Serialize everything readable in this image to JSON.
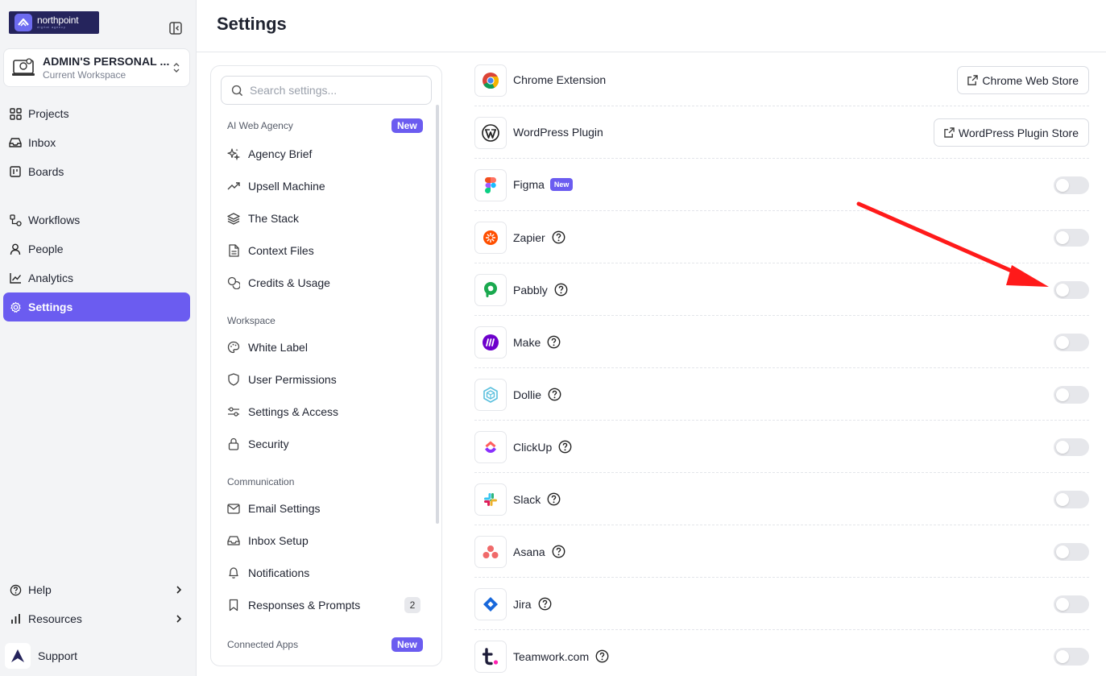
{
  "brand": {
    "name": "northpoint",
    "tagline": "digital agency",
    "logo_color": "#25245c",
    "accent": "#6b5cf0"
  },
  "workspace": {
    "title": "ADMIN'S PERSONAL ...",
    "subtitle": "Current Workspace"
  },
  "nav": {
    "top": [
      {
        "label": "Projects",
        "icon": "grid-icon"
      },
      {
        "label": "Inbox",
        "icon": "inbox-icon"
      },
      {
        "label": "Boards",
        "icon": "kanban-icon"
      }
    ],
    "middle": [
      {
        "label": "Workflows",
        "icon": "workflow-icon"
      },
      {
        "label": "People",
        "icon": "person-icon"
      },
      {
        "label": "Analytics",
        "icon": "line-chart-icon"
      },
      {
        "label": "Settings",
        "icon": "gear-icon",
        "active": true
      }
    ],
    "bottom": [
      {
        "label": "Help",
        "icon": "help-circle-icon"
      },
      {
        "label": "Resources",
        "icon": "bar-chart-icon"
      }
    ],
    "support": "Support"
  },
  "header": {
    "title": "Settings"
  },
  "settings": {
    "search_placeholder": "Search settings...",
    "sections": [
      {
        "label": "AI Web Agency",
        "badge": "New",
        "items": [
          "Agency Brief",
          "Upsell Machine",
          "The Stack",
          "Context Files",
          "Credits & Usage"
        ]
      },
      {
        "label": "Workspace",
        "items": [
          "White Label",
          "User Permissions",
          "Settings & Access",
          "Security"
        ]
      },
      {
        "label": "Communication",
        "items": [
          "Email Settings",
          "Inbox Setup",
          "Notifications",
          "Responses & Prompts"
        ],
        "counts": {
          "Responses & Prompts": "2"
        }
      },
      {
        "label": "Connected Apps",
        "badge": "New"
      }
    ]
  },
  "integrations": [
    {
      "name": "Chrome Extension",
      "icon": "chrome-icon",
      "action": "Chrome Web Store"
    },
    {
      "name": "WordPress Plugin",
      "icon": "wordpress-icon",
      "action": "WordPress Plugin Store"
    },
    {
      "name": "Figma",
      "icon": "figma-icon",
      "badge": "New",
      "enabled": false
    },
    {
      "name": "Zapier",
      "icon": "zapier-icon",
      "help": true,
      "enabled": false
    },
    {
      "name": "Pabbly",
      "icon": "pabbly-icon",
      "help": true,
      "enabled": false
    },
    {
      "name": "Make",
      "icon": "make-icon",
      "help": true,
      "enabled": false
    },
    {
      "name": "Dollie",
      "icon": "dollie-icon",
      "help": true,
      "enabled": false
    },
    {
      "name": "ClickUp",
      "icon": "clickup-icon",
      "help": true,
      "enabled": false
    },
    {
      "name": "Slack",
      "icon": "slack-icon",
      "help": true,
      "enabled": false
    },
    {
      "name": "Asana",
      "icon": "asana-icon",
      "help": true,
      "enabled": false
    },
    {
      "name": "Jira",
      "icon": "jira-icon",
      "help": true,
      "enabled": false
    },
    {
      "name": "Teamwork.com",
      "icon": "teamwork-icon",
      "help": true,
      "enabled": false
    }
  ],
  "annotation": {
    "type": "arrow",
    "color": "#ff1a1a",
    "points_to": "Pabbly toggle"
  }
}
